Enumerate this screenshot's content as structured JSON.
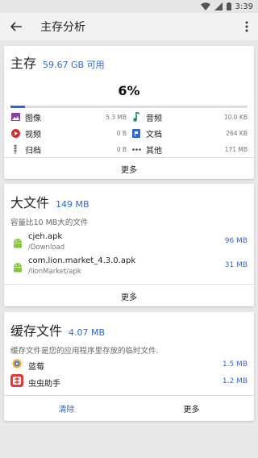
{
  "status": {
    "time": "3:39"
  },
  "toolbar": {
    "title": "主存分析"
  },
  "storage": {
    "title": "主存",
    "available": "59.67 GB 可用",
    "percent_text": "6%",
    "percent_used": 0.06,
    "categories": [
      {
        "label": "图像",
        "size": "5.3 MB",
        "icon": "image-icon",
        "color": "#8e3fa6"
      },
      {
        "label": "音频",
        "size": "10.0 KB",
        "icon": "music-note-icon",
        "color": "#1e8a5e"
      },
      {
        "label": "视频",
        "size": "0 B",
        "icon": "video-play-icon",
        "color": "#d32f2f"
      },
      {
        "label": "文档",
        "size": "264 KB",
        "icon": "document-icon",
        "color": "#3367d6"
      },
      {
        "label": "归档",
        "size": "0 B",
        "icon": "zipper-icon",
        "color": "#555555"
      },
      {
        "label": "其他",
        "size": "171 MB",
        "icon": "more-dots-icon",
        "color": "#444444"
      }
    ],
    "more_label": "更多"
  },
  "large_files": {
    "title": "大文件",
    "total": "149 MB",
    "description": "容量比10 MB大的文件",
    "files": [
      {
        "name": "cjeh.apk",
        "path": "/Download",
        "size": "96 MB",
        "icon": "android-icon"
      },
      {
        "name": "com.lion.market_4.3.0.apk",
        "path": "/lionMarket/apk",
        "size": "31 MB",
        "icon": "android-icon"
      }
    ],
    "more_label": "更多"
  },
  "cache": {
    "title": "缓存文件",
    "total": "4.07 MB",
    "description": "缓存文件是您的应用程序里存放的临时文件.",
    "apps": [
      {
        "name": "蓝莓",
        "size": "1.5 MB",
        "icon": "lanmei-app-icon"
      },
      {
        "name": "虫虫助手",
        "size": "1.2 MB",
        "icon": "chongchong-app-icon"
      }
    ],
    "clear_label": "清除",
    "more_label": "更多"
  },
  "colors": {
    "accent": "#3367d6",
    "android": "#8bc34a"
  }
}
